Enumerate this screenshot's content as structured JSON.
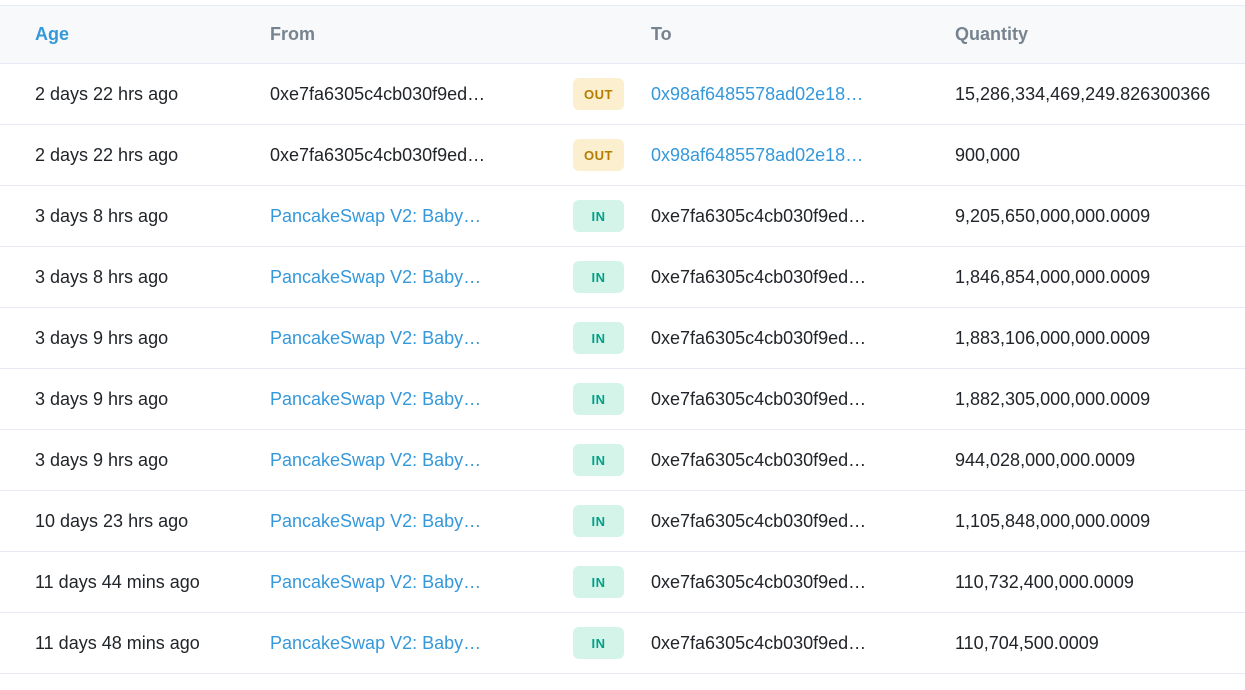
{
  "headers": {
    "age": "Age",
    "from": "From",
    "to": "To",
    "quantity": "Quantity"
  },
  "rows": [
    {
      "age": "2 days 22 hrs ago",
      "from": "0xe7fa6305c4cb030f9ed…",
      "from_link": false,
      "direction": "OUT",
      "to": "0x98af6485578ad02e18…",
      "to_link": true,
      "quantity": "15,286,334,469,249.826300366"
    },
    {
      "age": "2 days 22 hrs ago",
      "from": "0xe7fa6305c4cb030f9ed…",
      "from_link": false,
      "direction": "OUT",
      "to": "0x98af6485578ad02e18…",
      "to_link": true,
      "quantity": "900,000"
    },
    {
      "age": "3 days 8 hrs ago",
      "from": "PancakeSwap V2: Baby…",
      "from_link": true,
      "direction": "IN",
      "to": "0xe7fa6305c4cb030f9ed…",
      "to_link": false,
      "quantity": "9,205,650,000,000.0009"
    },
    {
      "age": "3 days 8 hrs ago",
      "from": "PancakeSwap V2: Baby…",
      "from_link": true,
      "direction": "IN",
      "to": "0xe7fa6305c4cb030f9ed…",
      "to_link": false,
      "quantity": "1,846,854,000,000.0009"
    },
    {
      "age": "3 days 9 hrs ago",
      "from": "PancakeSwap V2: Baby…",
      "from_link": true,
      "direction": "IN",
      "to": "0xe7fa6305c4cb030f9ed…",
      "to_link": false,
      "quantity": "1,883,106,000,000.0009"
    },
    {
      "age": "3 days 9 hrs ago",
      "from": "PancakeSwap V2: Baby…",
      "from_link": true,
      "direction": "IN",
      "to": "0xe7fa6305c4cb030f9ed…",
      "to_link": false,
      "quantity": "1,882,305,000,000.0009"
    },
    {
      "age": "3 days 9 hrs ago",
      "from": "PancakeSwap V2: Baby…",
      "from_link": true,
      "direction": "IN",
      "to": "0xe7fa6305c4cb030f9ed…",
      "to_link": false,
      "quantity": "944,028,000,000.0009"
    },
    {
      "age": "10 days 23 hrs ago",
      "from": "PancakeSwap V2: Baby…",
      "from_link": true,
      "direction": "IN",
      "to": "0xe7fa6305c4cb030f9ed…",
      "to_link": false,
      "quantity": "1,105,848,000,000.0009"
    },
    {
      "age": "11 days 44 mins ago",
      "from": "PancakeSwap V2: Baby…",
      "from_link": true,
      "direction": "IN",
      "to": "0xe7fa6305c4cb030f9ed…",
      "to_link": false,
      "quantity": "110,732,400,000.0009"
    },
    {
      "age": "11 days 48 mins ago",
      "from": "PancakeSwap V2: Baby…",
      "from_link": true,
      "direction": "IN",
      "to": "0xe7fa6305c4cb030f9ed…",
      "to_link": false,
      "quantity": "110,704,500.0009"
    }
  ],
  "colors": {
    "link": "#3498db",
    "out_bg": "#fbefcf",
    "out_text": "#b47d00",
    "in_bg": "#d4f4ea",
    "in_text": "#00a186"
  }
}
